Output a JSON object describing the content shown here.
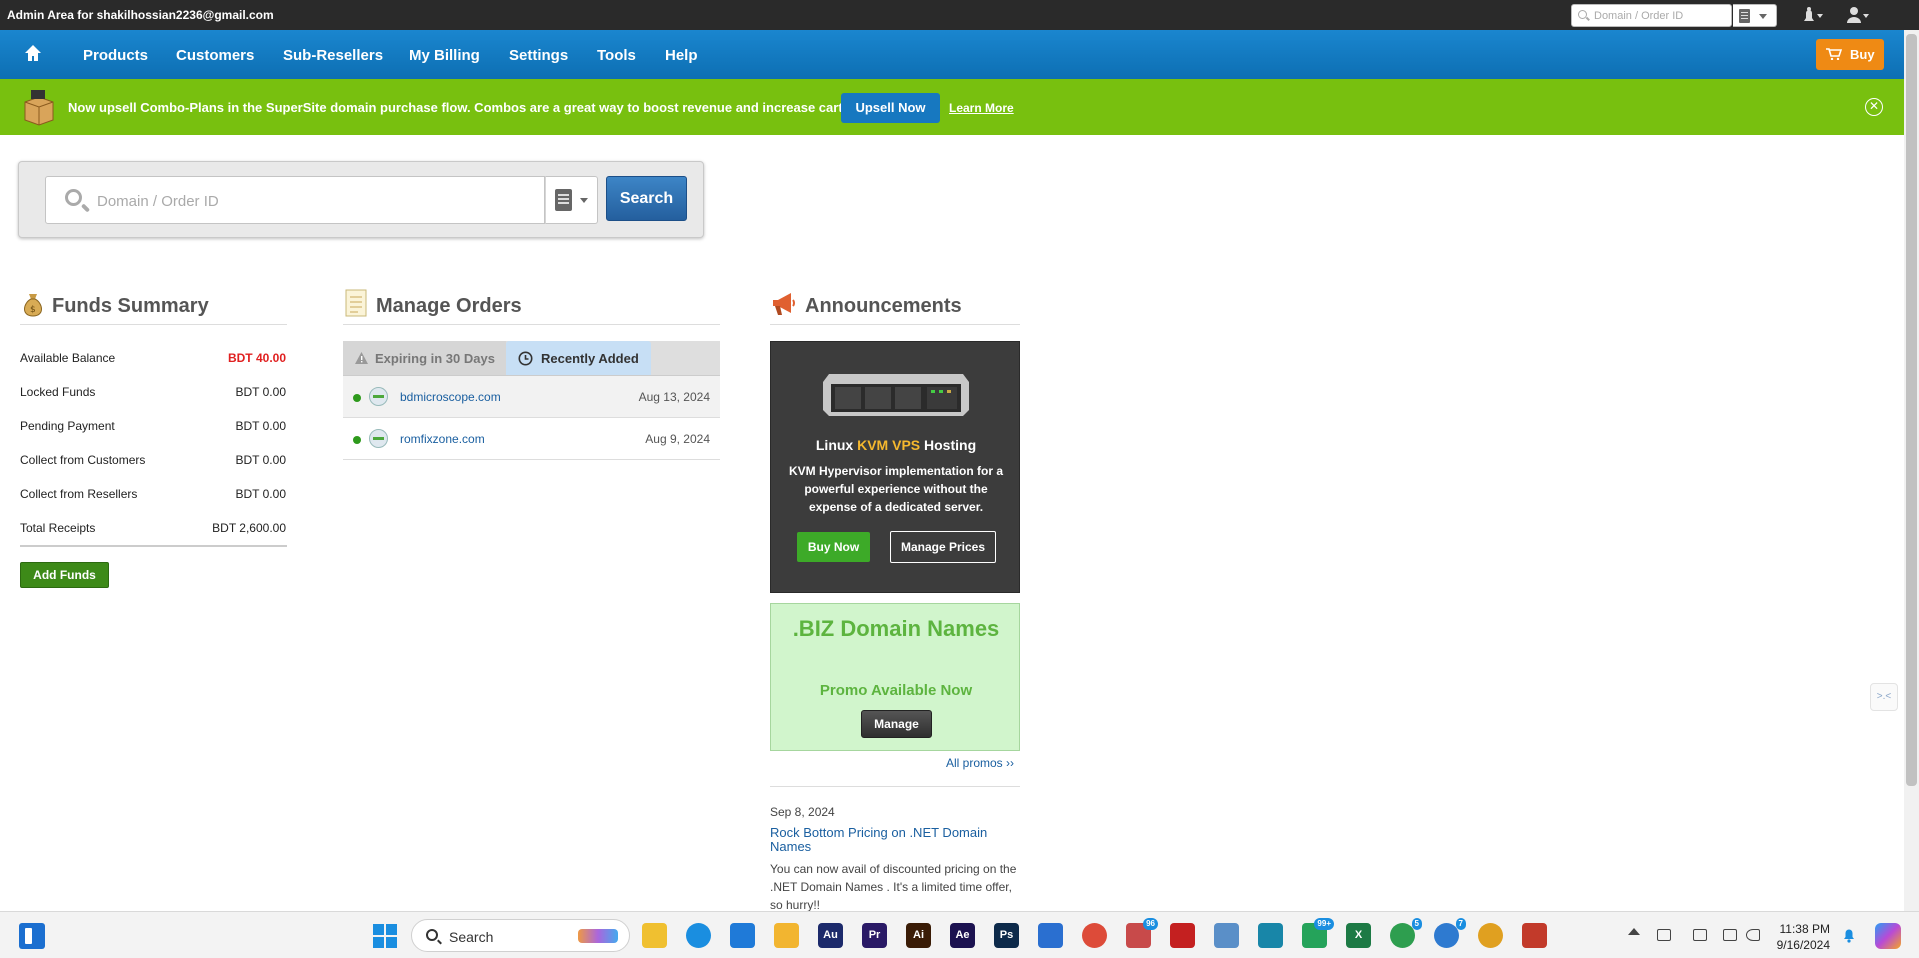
{
  "topbar": {
    "admin_text": "Admin Area for shakilhossian2236@gmail.com",
    "search_placeholder": "Domain / Order ID"
  },
  "nav": {
    "items": [
      "Products",
      "Customers",
      "Sub-Resellers",
      "My Billing",
      "Settings",
      "Tools",
      "Help"
    ],
    "buy_label": "Buy"
  },
  "banner": {
    "text": "Now upsell Combo-Plans in the SuperSite domain purchase flow. Combos are a great way to boost revenue and increase cart value.",
    "upsell_label": "Upsell Now",
    "learn_more_label": "Learn More",
    "close_glyph": "✕"
  },
  "search": {
    "placeholder": "Domain / Order ID",
    "button_label": "Search"
  },
  "funds": {
    "title": "Funds Summary",
    "rows": [
      {
        "label": "Available Balance",
        "value": "BDT 40.00"
      },
      {
        "label": "Locked Funds",
        "value": "BDT 0.00"
      },
      {
        "label": "Pending Payment",
        "value": "BDT 0.00"
      },
      {
        "label": "Collect from Customers",
        "value": "BDT 0.00"
      },
      {
        "label": "Collect from Resellers",
        "value": "BDT 0.00"
      },
      {
        "label": "Total Receipts",
        "value": "BDT 2,600.00"
      }
    ],
    "add_funds_label": "Add Funds",
    "available_color": "#e02020"
  },
  "orders": {
    "title": "Manage Orders",
    "tabs": [
      "Expiring in 30 Days",
      "Recently Added"
    ],
    "active_tab": "Recently Added",
    "rows": [
      {
        "domain": "bdmicroscope.com",
        "date": "Aug 13, 2024"
      },
      {
        "domain": "romfixzone.com",
        "date": "Aug 9, 2024"
      }
    ]
  },
  "announcements": {
    "title": "Announcements",
    "kvm": {
      "title_pre": "Linux ",
      "title_hl": "KVM VPS",
      "title_post": " Hosting",
      "desc": "KVM Hypervisor implementation for a powerful experience without the expense of a dedicated server.",
      "buy_label": "Buy Now",
      "manage_label": "Manage Prices"
    },
    "biz": {
      "title": ".BIZ Domain Names",
      "promo": "Promo Available Now",
      "manage_label": "Manage"
    },
    "all_promos_label": "All promos ››",
    "news": {
      "date": "Sep 8, 2024",
      "title": "Rock Bottom Pricing on .NET Domain Names",
      "body": "You can now avail of discounted pricing on the .NET Domain Names . It's a limited time offer, so hurry!!"
    }
  },
  "side_widget": ">.<",
  "taskbar": {
    "search_label": "Search",
    "time": "11:38 PM",
    "date": "9/16/2024",
    "apps": [
      {
        "name": "file-explorer-icon",
        "text": "",
        "color": "#f0c030"
      },
      {
        "name": "edge-icon",
        "text": "",
        "color": "#1a8ee0"
      },
      {
        "name": "vscode-icon",
        "text": "",
        "color": "#1f7ad8"
      },
      {
        "name": "folder-icon",
        "text": "",
        "color": "#f2b530"
      },
      {
        "name": "audition-icon",
        "text": "Au",
        "color": "#1c2a6b"
      },
      {
        "name": "premiere-icon",
        "text": "Pr",
        "color": "#2a1a66"
      },
      {
        "name": "illustrator-icon",
        "text": "Ai",
        "color": "#3a1c06"
      },
      {
        "name": "after-effects-icon",
        "text": "Ae",
        "color": "#1c1250"
      },
      {
        "name": "photoshop-icon",
        "text": "Ps",
        "color": "#0d2a4a"
      },
      {
        "name": "store-icon",
        "text": "",
        "color": "#2a6fd0"
      },
      {
        "name": "chrome-icon",
        "text": "",
        "color": "#dd4b39"
      },
      {
        "name": "telegram-icon",
        "text": "",
        "color": "#c84a4a"
      },
      {
        "name": "davinci-icon",
        "text": "",
        "color": "#c42020"
      },
      {
        "name": "photos-icon",
        "text": "",
        "color": "#5a8fc8"
      },
      {
        "name": "sticky-app-icon",
        "text": "",
        "color": "#1886a8"
      },
      {
        "name": "whatsapp-icon",
        "text": "",
        "color": "#25a35a"
      },
      {
        "name": "excel-icon",
        "text": "X",
        "color": "#1d7a45"
      },
      {
        "name": "chrome-profile-2-icon",
        "text": "",
        "color": "#2e9e4f"
      },
      {
        "name": "chrome-profile-3-icon",
        "text": "",
        "color": "#2e7ad0"
      },
      {
        "name": "chrome-profile-4-icon",
        "text": "",
        "color": "#e0a020"
      },
      {
        "name": "snipping-icon",
        "text": "",
        "color": "#c23a2a"
      }
    ],
    "badges": {
      "telegram": "96",
      "whatsapp": "99+",
      "chrome2": "5",
      "chrome3": "7"
    }
  }
}
